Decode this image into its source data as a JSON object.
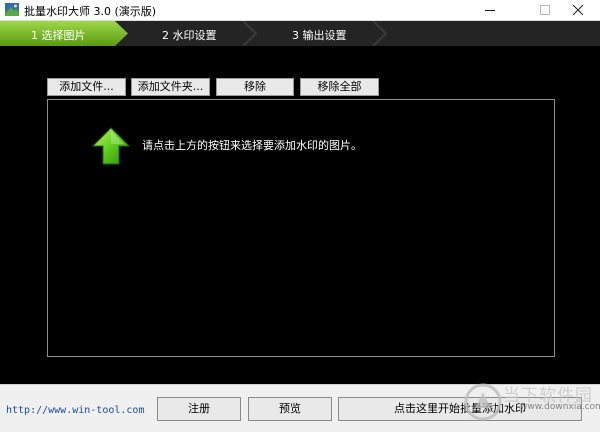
{
  "window": {
    "title": "批量水印大师 3.0 (演示版)",
    "controls": [
      "minimize",
      "maximize",
      "close"
    ]
  },
  "steps": [
    {
      "label": "1  选择图片",
      "active": true
    },
    {
      "label": "2  水印设置",
      "active": false
    },
    {
      "label": "3  输出设置",
      "active": false
    }
  ],
  "toolbar": {
    "add_file": "添加文件...",
    "add_folder": "添加文件夹...",
    "remove": "移除",
    "remove_all": "移除全部"
  },
  "panel": {
    "hint": "请点击上方的按钮来选择要添加水印的图片。",
    "icon": "up-arrow-icon"
  },
  "bottom": {
    "site_link": "http://www.win-tool.com",
    "register": "注册",
    "preview": "预览",
    "start": "点击这里开始批量添加水印"
  },
  "watermark": {
    "brand": "当下软件园",
    "url": "www.downxia.com"
  },
  "colors": {
    "accent_green": "#7fbf1f",
    "background": "#000000",
    "link": "#1a4ba8"
  }
}
